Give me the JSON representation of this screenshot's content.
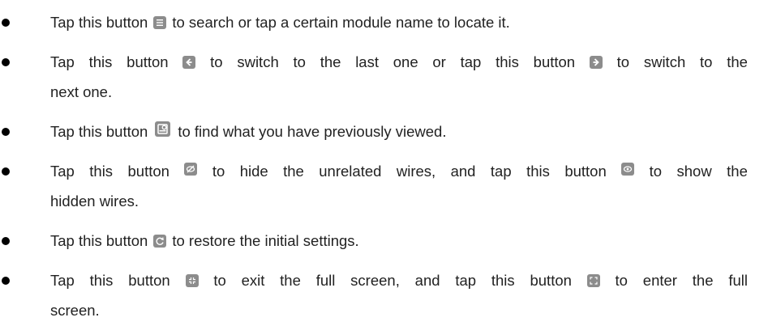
{
  "items": [
    {
      "lines": [
        [
          "Tap this button",
          "to search or tap a certain module name to locate it."
        ]
      ],
      "icons": [
        "list-menu-icon"
      ]
    },
    {
      "lines": [
        [
          "Tap",
          "this",
          "button",
          "to",
          "switch",
          "to",
          "the",
          "last",
          "one",
          "or",
          "tap",
          "this",
          "button",
          "to",
          "switch",
          "to",
          "the"
        ],
        [
          "next one."
        ]
      ],
      "icons": [
        "arrow-left-icon",
        "arrow-right-icon"
      ]
    },
    {
      "lines": [
        [
          "Tap this button",
          "to find what you have previously viewed."
        ]
      ],
      "icons": [
        "history-icon"
      ]
    },
    {
      "lines": [
        [
          "Tap",
          "this",
          "button",
          "to",
          "hide",
          "the",
          "unrelated",
          "wires,",
          "and",
          "tap",
          "this",
          "button",
          "to",
          "show",
          "the"
        ],
        [
          "hidden wires."
        ]
      ],
      "icons": [
        "hide-eye-icon",
        "show-eye-icon"
      ]
    },
    {
      "lines": [
        [
          "Tap this button",
          "to restore the initial settings."
        ]
      ],
      "icons": [
        "restore-icon"
      ]
    },
    {
      "lines": [
        [
          "Tap",
          "this",
          "button",
          "to",
          "exit",
          "the",
          "full",
          "screen,",
          "and",
          "tap",
          "this",
          "button",
          "to",
          "enter",
          "the",
          "full"
        ],
        [
          "screen."
        ]
      ],
      "icons": [
        "exit-fullscreen-icon",
        "enter-fullscreen-icon"
      ]
    }
  ]
}
